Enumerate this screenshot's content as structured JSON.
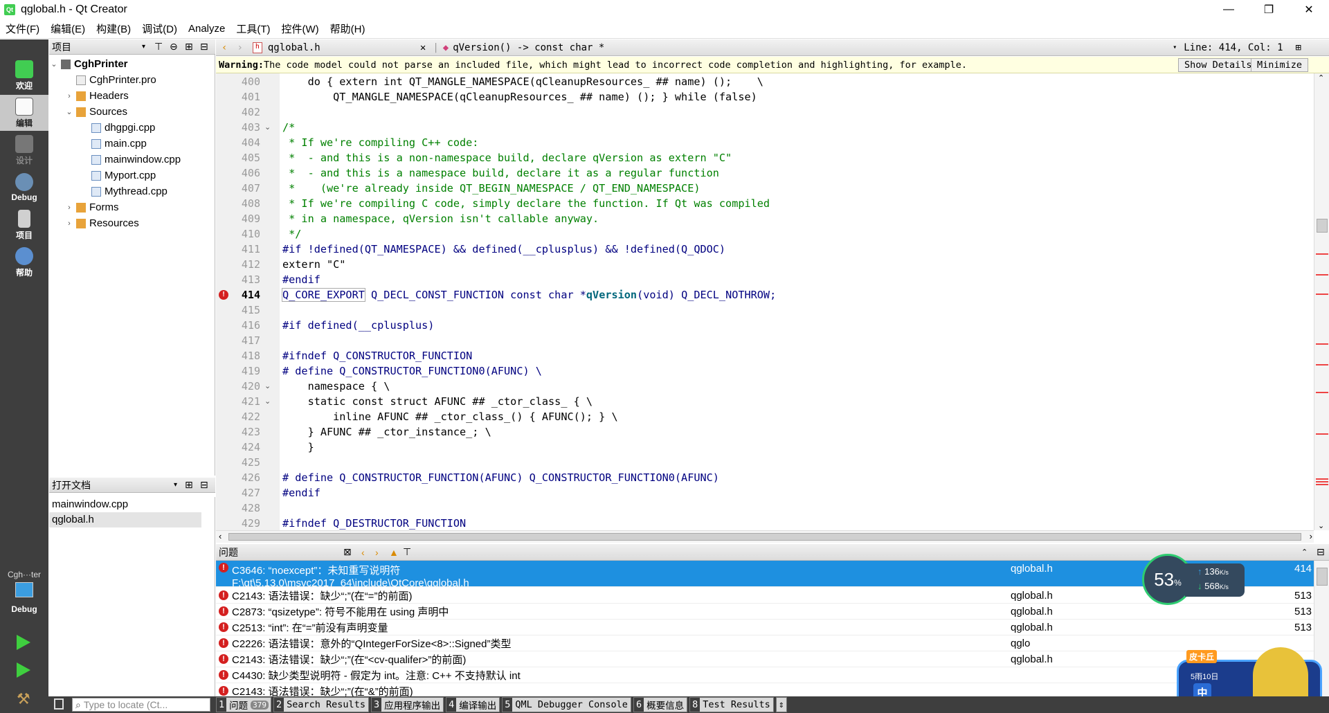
{
  "window": {
    "title": "qglobal.h - Qt Creator",
    "logo": "Qt",
    "controls": [
      "—",
      "❐",
      "✕"
    ]
  },
  "menu": [
    "文件(F)",
    "编辑(E)",
    "构建(B)",
    "调试(D)",
    "Analyze",
    "工具(T)",
    "控件(W)",
    "帮助(H)"
  ],
  "modes": [
    {
      "label": "欢迎",
      "icon": "welcome-icon"
    },
    {
      "label": "编辑",
      "icon": "edit-icon"
    },
    {
      "label": "设计",
      "icon": "design-icon"
    },
    {
      "label": "Debug",
      "icon": "debug-icon"
    },
    {
      "label": "项目",
      "icon": "projects-icon"
    },
    {
      "label": "帮助",
      "icon": "help-icon"
    }
  ],
  "kit": {
    "project": "Cgh···ter",
    "mode": "Debug"
  },
  "project_panel": {
    "title": "项目",
    "tree": [
      {
        "label": "CghPrinter",
        "level": 0,
        "arrow": "⌄",
        "bold": true
      },
      {
        "label": "CghPrinter.pro",
        "level": 1,
        "arrow": ""
      },
      {
        "label": "Headers",
        "level": 1,
        "arrow": "›"
      },
      {
        "label": "Sources",
        "level": 1,
        "arrow": "⌄"
      },
      {
        "label": "dhgpgi.cpp",
        "level": 2,
        "arrow": ""
      },
      {
        "label": "main.cpp",
        "level": 2,
        "arrow": ""
      },
      {
        "label": "mainwindow.cpp",
        "level": 2,
        "arrow": ""
      },
      {
        "label": "Myport.cpp",
        "level": 2,
        "arrow": ""
      },
      {
        "label": "Mythread.cpp",
        "level": 2,
        "arrow": ""
      },
      {
        "label": "Forms",
        "level": 1,
        "arrow": "›"
      },
      {
        "label": "Resources",
        "level": 1,
        "arrow": "›"
      }
    ]
  },
  "open_docs": {
    "title": "打开文档",
    "items": [
      "mainwindow.cpp",
      "qglobal.h"
    ],
    "selected": 1
  },
  "editor": {
    "file": "qglobal.h",
    "symbol": "qVersion() -> const char *",
    "position": "Line: 414, Col: 1",
    "warning_label": "Warning:",
    "warning_text": " The code model could not parse an included file, which might lead to incorrect code completion and highlighting, for example.",
    "show_details": "Show Details",
    "minimize": "Minimize",
    "lines": [
      {
        "n": "400",
        "t": "    do { extern int QT_MANGLE_NAMESPACE(qCleanupResources_ ## name) ();    \\"
      },
      {
        "n": "401",
        "t": "        QT_MANGLE_NAMESPACE(qCleanupResources_ ## name) (); } while (false)"
      },
      {
        "n": "402",
        "t": ""
      },
      {
        "n": "403",
        "t": "/*",
        "fold": true,
        "c": "cmt"
      },
      {
        "n": "404",
        "t": " * If we're compiling C++ code:",
        "c": "cmt"
      },
      {
        "n": "405",
        "t": " *  - and this is a non-namespace build, declare qVersion as extern \"C\"",
        "c": "cmt"
      },
      {
        "n": "406",
        "t": " *  - and this is a namespace build, declare it as a regular function",
        "c": "cmt"
      },
      {
        "n": "407",
        "t": " *    (we're already inside QT_BEGIN_NAMESPACE / QT_END_NAMESPACE)",
        "c": "cmt"
      },
      {
        "n": "408",
        "t": " * If we're compiling C code, simply declare the function. If Qt was compiled",
        "c": "cmt"
      },
      {
        "n": "409",
        "t": " * in a namespace, qVersion isn't callable anyway.",
        "c": "cmt"
      },
      {
        "n": "410",
        "t": " */",
        "c": "cmt"
      },
      {
        "n": "411",
        "t": "#if !defined(QT_NAMESPACE) && defined(__cplusplus) && !defined(Q_QDOC)",
        "c": "mac"
      },
      {
        "n": "412",
        "t": "extern \"C\""
      },
      {
        "n": "413",
        "t": "#endif",
        "c": "mac"
      },
      {
        "n": "414",
        "t": "Q_CORE_EXPORT Q_DECL_CONST_FUNCTION const char *qVersion(void) Q_DECL_NOTHROW;",
        "bp": true
      },
      {
        "n": "415",
        "t": ""
      },
      {
        "n": "416",
        "t": "#if defined(__cplusplus)",
        "c": "mac"
      },
      {
        "n": "417",
        "t": ""
      },
      {
        "n": "418",
        "t": "#ifndef Q_CONSTRUCTOR_FUNCTION",
        "c": "mac"
      },
      {
        "n": "419",
        "t": "# define Q_CONSTRUCTOR_FUNCTION0(AFUNC) \\",
        "c": "mac"
      },
      {
        "n": "420",
        "t": "    namespace { \\",
        "fold": true
      },
      {
        "n": "421",
        "t": "    static const struct AFUNC ## _ctor_class_ { \\",
        "fold": true
      },
      {
        "n": "422",
        "t": "        inline AFUNC ## _ctor_class_() { AFUNC(); } \\"
      },
      {
        "n": "423",
        "t": "    } AFUNC ## _ctor_instance_; \\"
      },
      {
        "n": "424",
        "t": "    }"
      },
      {
        "n": "425",
        "t": ""
      },
      {
        "n": "426",
        "t": "# define Q_CONSTRUCTOR_FUNCTION(AFUNC) Q_CONSTRUCTOR_FUNCTION0(AFUNC)",
        "c": "mac"
      },
      {
        "n": "427",
        "t": "#endif",
        "c": "mac"
      },
      {
        "n": "428",
        "t": ""
      },
      {
        "n": "429",
        "t": "#ifndef Q_DESTRUCTOR_FUNCTION",
        "c": "mac"
      }
    ]
  },
  "issues_panel": {
    "title": "问题",
    "items": [
      {
        "text": "C3646: “noexcept”：未知重写说明符",
        "path": "F:\\qt\\5.13.0\\msvc2017_64\\include\\QtCore\\qglobal.h",
        "file": "qglobal.h",
        "line": "414",
        "selected": true
      },
      {
        "text": "C2143: 语法错误：缺少“;”(在“=”的前面)",
        "file": "qglobal.h",
        "line": "513"
      },
      {
        "text": "C2873: “qsizetype”: 符号不能用在 using 声明中",
        "file": "qglobal.h",
        "line": "513"
      },
      {
        "text": "C2513: “int”: 在“=”前没有声明变量",
        "file": "qglobal.h",
        "line": "513"
      },
      {
        "text": "C2226: 语法错误：意外的“QIntegerForSize<8>::Signed”类型",
        "file": "qglo",
        "line": ""
      },
      {
        "text": "C2143: 语法错误：缺少“;”(在“<cv-qualifer>”的前面)",
        "file": "qglobal.h",
        "line": ""
      },
      {
        "text": "C4430: 缺少类型说明符 - 假定为 int。注意: C++ 不支持默认 int",
        "file": "",
        "line": ""
      },
      {
        "text": "C2143: 语法错误：缺少“;”(在“&”的前面)",
        "file": "",
        "line": ""
      }
    ]
  },
  "bottom": {
    "locator_placeholder": "Type to locate (Ct...",
    "tabs": [
      {
        "num": "1",
        "label": "问题",
        "badge": "379"
      },
      {
        "num": "2",
        "label": "Search Results"
      },
      {
        "num": "3",
        "label": "应用程序输出"
      },
      {
        "num": "4",
        "label": "编译输出"
      },
      {
        "num": "5",
        "label": "QML Debugger Console"
      },
      {
        "num": "6",
        "label": "概要信息"
      },
      {
        "num": "8",
        "label": "Test Results"
      }
    ]
  },
  "net_widget": {
    "percent": "53",
    "percent_unit": "%",
    "up": "136",
    "down": "568",
    "unit": "K/s"
  },
  "ad_badge": {
    "text1": "皮卡丘",
    "text2": "5雨10日",
    "text3": "中"
  }
}
